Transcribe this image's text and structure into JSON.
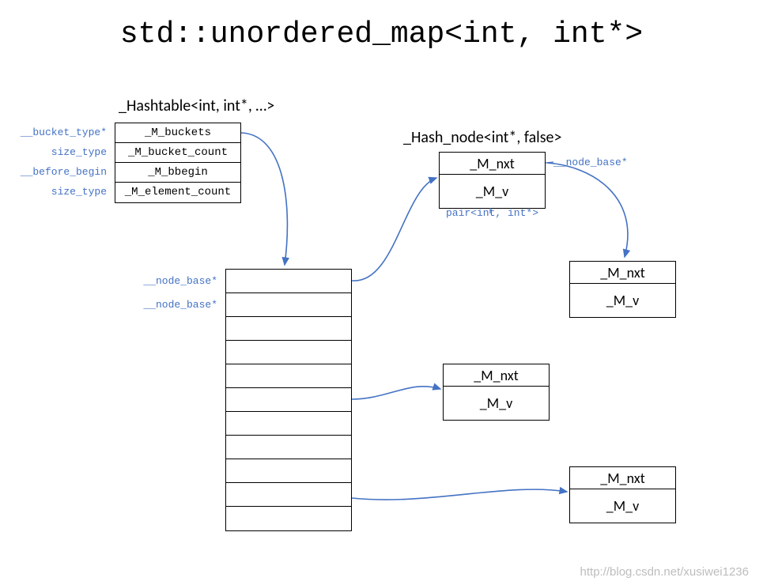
{
  "title": "std::unordered_map<int, int*>",
  "hashtable_label": "_Hashtable<int, int*, …>",
  "hashnode_label": "_Hash_node<int*, false>",
  "hashtable_rows": [
    {
      "type": "__bucket_type*",
      "name": "_M_buckets"
    },
    {
      "type": "size_type",
      "name": "_M_bucket_count"
    },
    {
      "type": "__before_begin",
      "name": "_M_bbegin"
    },
    {
      "type": "size_type",
      "name": "_M_element_count"
    }
  ],
  "bucket_labels": [
    "__node_base*",
    "__node_base*"
  ],
  "node_fields": {
    "nxt": "_M_nxt",
    "v": "_M_v"
  },
  "node1_annot_right": "__node_base*",
  "node1_annot_below": "pair<int, int*>",
  "watermark": "http://blog.csdn.net/xusiwei1236"
}
